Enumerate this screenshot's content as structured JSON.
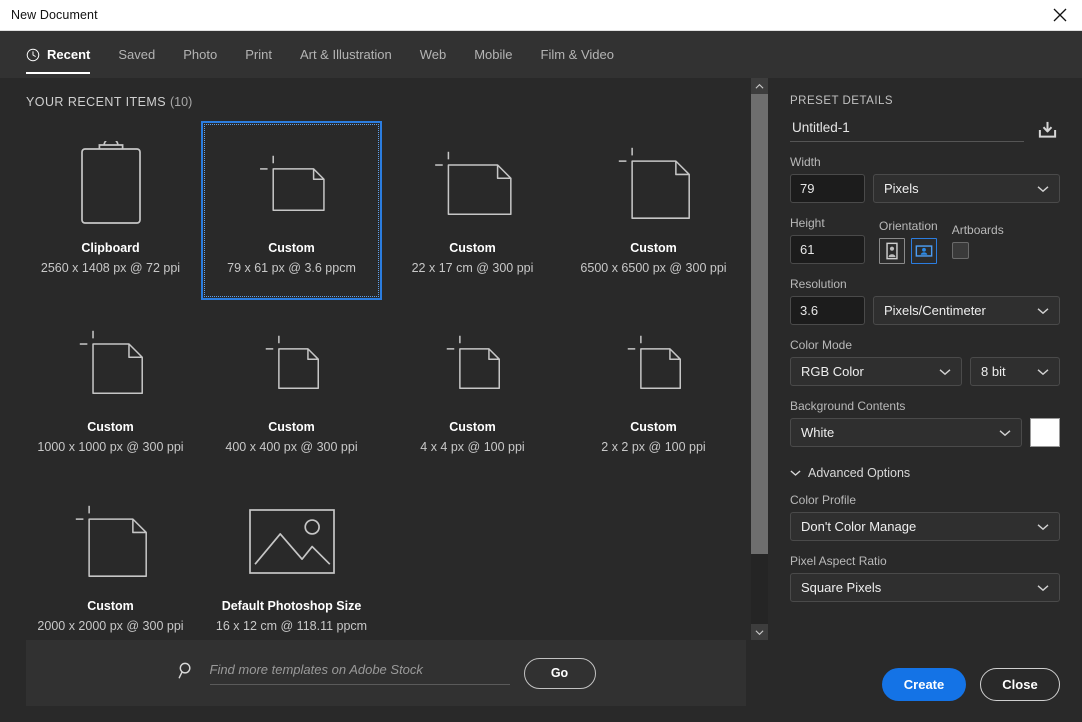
{
  "window": {
    "title": "New Document",
    "close_icon": "close-icon"
  },
  "tabs": [
    {
      "label": "Recent",
      "icon": "clock-icon",
      "active": true
    },
    {
      "label": "Saved",
      "active": false
    },
    {
      "label": "Photo",
      "active": false
    },
    {
      "label": "Print",
      "active": false
    },
    {
      "label": "Art & Illustration",
      "active": false
    },
    {
      "label": "Web",
      "active": false
    },
    {
      "label": "Mobile",
      "active": false
    },
    {
      "label": "Film & Video",
      "active": false
    }
  ],
  "recent": {
    "heading": "YOUR RECENT ITEMS",
    "count": "(10)",
    "items": [
      {
        "name": "Clipboard",
        "meta": "2560 x 1408 px @ 72 ppi",
        "icon": "clipboard-icon",
        "selected": false,
        "w": 58,
        "h": 74
      },
      {
        "name": "Custom",
        "meta": "79 x 61 px @ 3.6 ppcm",
        "icon": "document-icon",
        "selected": true,
        "w": 54,
        "h": 44
      },
      {
        "name": "Custom",
        "meta": "22 x 17 cm @ 300 ppi",
        "icon": "document-icon",
        "selected": false,
        "w": 66,
        "h": 52
      },
      {
        "name": "Custom",
        "meta": "6500 x 6500 px @ 300 ppi",
        "icon": "document-icon",
        "selected": false,
        "w": 60,
        "h": 60
      },
      {
        "name": "Custom",
        "meta": "1000 x 1000 px @ 300 ppi",
        "icon": "document-icon",
        "selected": false,
        "w": 52,
        "h": 52
      },
      {
        "name": "Custom",
        "meta": "400 x 400 px @ 300 ppi",
        "icon": "document-icon",
        "selected": false,
        "w": 42,
        "h": 42
      },
      {
        "name": "Custom",
        "meta": "4 x 4 px @ 100 ppi",
        "icon": "document-icon",
        "selected": false,
        "w": 42,
        "h": 42
      },
      {
        "name": "Custom",
        "meta": "2 x 2 px @ 100 ppi",
        "icon": "document-icon",
        "selected": false,
        "w": 42,
        "h": 42
      },
      {
        "name": "Custom",
        "meta": "2000 x 2000 px @ 300 ppi",
        "icon": "document-icon",
        "selected": false,
        "w": 60,
        "h": 60
      },
      {
        "name": "Default Photoshop Size",
        "meta": "16 x 12 cm @ 118.11 ppcm",
        "icon": "photo-icon",
        "selected": false,
        "w": 84,
        "h": 63
      }
    ]
  },
  "stock": {
    "search_icon": "search-icon",
    "placeholder": "Find more templates on Adobe Stock",
    "value": "",
    "go_label": "Go"
  },
  "preset": {
    "title": "PRESET DETAILS",
    "name_value": "Untitled-1",
    "save_icon": "save-preset-icon",
    "width": {
      "label": "Width",
      "value": "79",
      "unit": "Pixels"
    },
    "height": {
      "label": "Height",
      "value": "61"
    },
    "orientation": {
      "label": "Orientation",
      "portrait_icon": "portrait-icon",
      "landscape_icon": "landscape-icon",
      "selected": "landscape"
    },
    "artboards": {
      "label": "Artboards",
      "checked": false
    },
    "resolution": {
      "label": "Resolution",
      "value": "3.6",
      "unit": "Pixels/Centimeter"
    },
    "color_mode": {
      "label": "Color Mode",
      "value": "RGB Color",
      "depth": "8 bit"
    },
    "background": {
      "label": "Background Contents",
      "value": "White",
      "swatch_color": "#ffffff"
    },
    "advanced_label": "Advanced Options",
    "color_profile": {
      "label": "Color Profile",
      "value": "Don't Color Manage"
    },
    "pixel_aspect": {
      "label": "Pixel Aspect Ratio",
      "value": "Square Pixels"
    }
  },
  "footer": {
    "create_label": "Create",
    "close_label": "Close"
  },
  "colors": {
    "accent": "#1473e6",
    "selection": "#2b7de0",
    "panel_bg": "#292929",
    "tabbar_bg": "#323232"
  }
}
